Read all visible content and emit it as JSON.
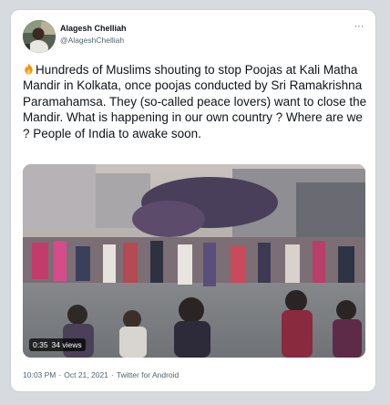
{
  "tweet": {
    "author_name": "Alagesh Chelliah",
    "author_handle": "@AlageshChelliah",
    "more_label": "···",
    "text": "Hundreds of Muslims shouting to stop Poojas at Kali Matha Mandir in Kolkata, once poojas conducted by Sri Ramakrishna Paramahamsa. They (so-called peace lovers) want to close the Mandir. What is happening in our own country ? Where are we ? People of India to awake soon.",
    "emoji_icon": "fire-icon",
    "video": {
      "duration": "0:35",
      "views": "34 views"
    },
    "time": "10:03 PM",
    "date": "Oct 21, 2021",
    "separator": "·",
    "source": "Twitter for Android"
  },
  "colors": {
    "text": "#0f1419",
    "secondary": "#536471",
    "border": "#c9d0d6"
  }
}
